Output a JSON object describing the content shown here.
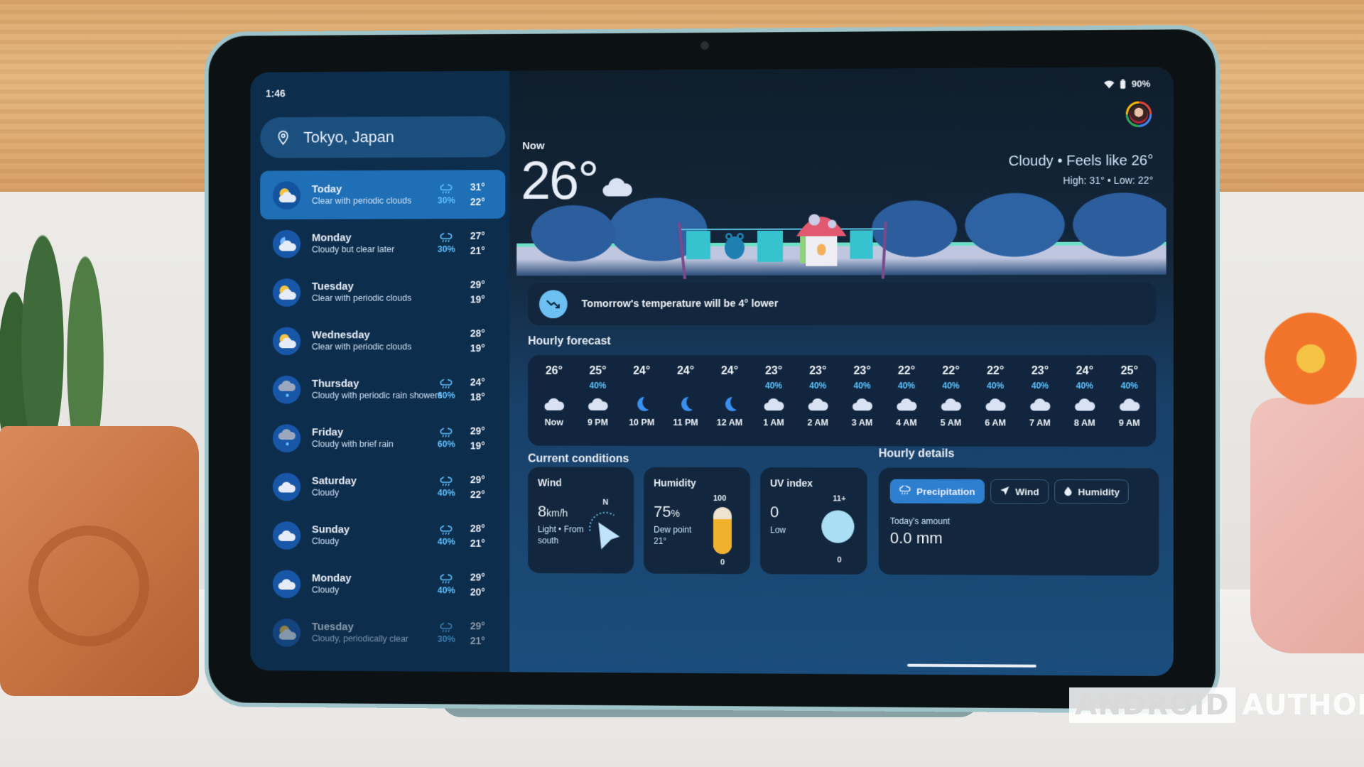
{
  "status_bar": {
    "time": "1:46",
    "battery": "90%"
  },
  "search": {
    "location": "Tokyo, Japan"
  },
  "daily": [
    {
      "name": "Today",
      "desc": "Clear with periodic clouds",
      "icon": "partly-cloudy-icon",
      "rain": "30%",
      "high": "31°",
      "low": "22°",
      "active": true
    },
    {
      "name": "Monday",
      "desc": "Cloudy but clear later",
      "icon": "night-cloudy-icon",
      "rain": "30%",
      "high": "27°",
      "low": "21°"
    },
    {
      "name": "Tuesday",
      "desc": "Clear with periodic clouds",
      "icon": "partly-cloudy-icon",
      "rain": "",
      "high": "29°",
      "low": "19°"
    },
    {
      "name": "Wednesday",
      "desc": "Clear with periodic clouds",
      "icon": "partly-cloudy-icon",
      "rain": "",
      "high": "28°",
      "low": "19°"
    },
    {
      "name": "Thursday",
      "desc": "Cloudy with periodic rain showers",
      "icon": "rain-cloud-icon",
      "rain": "60%",
      "high": "24°",
      "low": "18°"
    },
    {
      "name": "Friday",
      "desc": "Cloudy with brief rain",
      "icon": "rain-cloud-icon",
      "rain": "60%",
      "high": "29°",
      "low": "19°"
    },
    {
      "name": "Saturday",
      "desc": "Cloudy",
      "icon": "cloud-icon",
      "rain": "40%",
      "high": "29°",
      "low": "22°"
    },
    {
      "name": "Sunday",
      "desc": "Cloudy",
      "icon": "cloud-icon",
      "rain": "40%",
      "high": "28°",
      "low": "21°"
    },
    {
      "name": "Monday",
      "desc": "Cloudy",
      "icon": "cloud-icon",
      "rain": "40%",
      "high": "29°",
      "low": "20°"
    },
    {
      "name": "Tuesday",
      "desc": "Cloudy, periodically clear",
      "icon": "partly-cloudy-icon",
      "rain": "30%",
      "high": "29°",
      "low": "21°"
    }
  ],
  "now": {
    "label": "Now",
    "temp": "26°",
    "condition": "Cloudy • Feels like 26°",
    "high_low": "High: 31° • Low: 22°"
  },
  "insight": {
    "message": "Tomorrow's temperature will be 4° lower"
  },
  "hourly": {
    "title": "Hourly forecast",
    "items": [
      {
        "temp": "26°",
        "precip": "",
        "icon": "cloud",
        "label": "Now"
      },
      {
        "temp": "25°",
        "precip": "40%",
        "icon": "cloud",
        "label": "9 PM"
      },
      {
        "temp": "24°",
        "precip": "",
        "icon": "moon",
        "label": "10 PM"
      },
      {
        "temp": "24°",
        "precip": "",
        "icon": "moon",
        "label": "11 PM"
      },
      {
        "temp": "24°",
        "precip": "",
        "icon": "moon",
        "label": "12 AM"
      },
      {
        "temp": "23°",
        "precip": "40%",
        "icon": "cloud",
        "label": "1 AM"
      },
      {
        "temp": "23°",
        "precip": "40%",
        "icon": "cloud",
        "label": "2 AM"
      },
      {
        "temp": "23°",
        "precip": "40%",
        "icon": "cloud",
        "label": "3 AM"
      },
      {
        "temp": "22°",
        "precip": "40%",
        "icon": "cloud",
        "label": "4 AM"
      },
      {
        "temp": "22°",
        "precip": "40%",
        "icon": "cloud",
        "label": "5 AM"
      },
      {
        "temp": "22°",
        "precip": "40%",
        "icon": "cloud",
        "label": "6 AM"
      },
      {
        "temp": "23°",
        "precip": "40%",
        "icon": "cloud",
        "label": "7 AM"
      },
      {
        "temp": "24°",
        "precip": "40%",
        "icon": "cloud",
        "label": "8 AM"
      },
      {
        "temp": "25°",
        "precip": "40%",
        "icon": "cloud",
        "label": "9 AM"
      }
    ]
  },
  "current_conditions": {
    "title": "Current conditions",
    "wind": {
      "title": "Wind",
      "speed": "8",
      "unit": "km/h",
      "desc": "Light • From south",
      "compass": "N"
    },
    "humidity": {
      "title": "Humidity",
      "value": "75",
      "unit": "%",
      "dew_label": "Dew point",
      "dew_value": "21°",
      "scale_max": "100",
      "scale_min": "0",
      "level": 0.75
    },
    "uv": {
      "title": "UV index",
      "value": "0",
      "level_label": "Low",
      "scale_max": "11+",
      "scale_min": "0"
    }
  },
  "hourly_details": {
    "title": "Hourly details",
    "tabs": [
      {
        "label": "Precipitation",
        "icon": "rain-icon",
        "active": true
      },
      {
        "label": "Wind",
        "icon": "navigation-arrow-icon"
      },
      {
        "label": "Humidity",
        "icon": "droplet-icon"
      }
    ],
    "amount_label": "Today's amount",
    "amount_value": "0.0 mm"
  },
  "watermark": {
    "left": "ANDROID",
    "right": "AUTHORITY"
  },
  "colors": {
    "accent": "#2f7fd0",
    "precip": "#5ec2ff",
    "humidity_fill": "#f2b12c",
    "uv_fill": "#a9def5"
  }
}
